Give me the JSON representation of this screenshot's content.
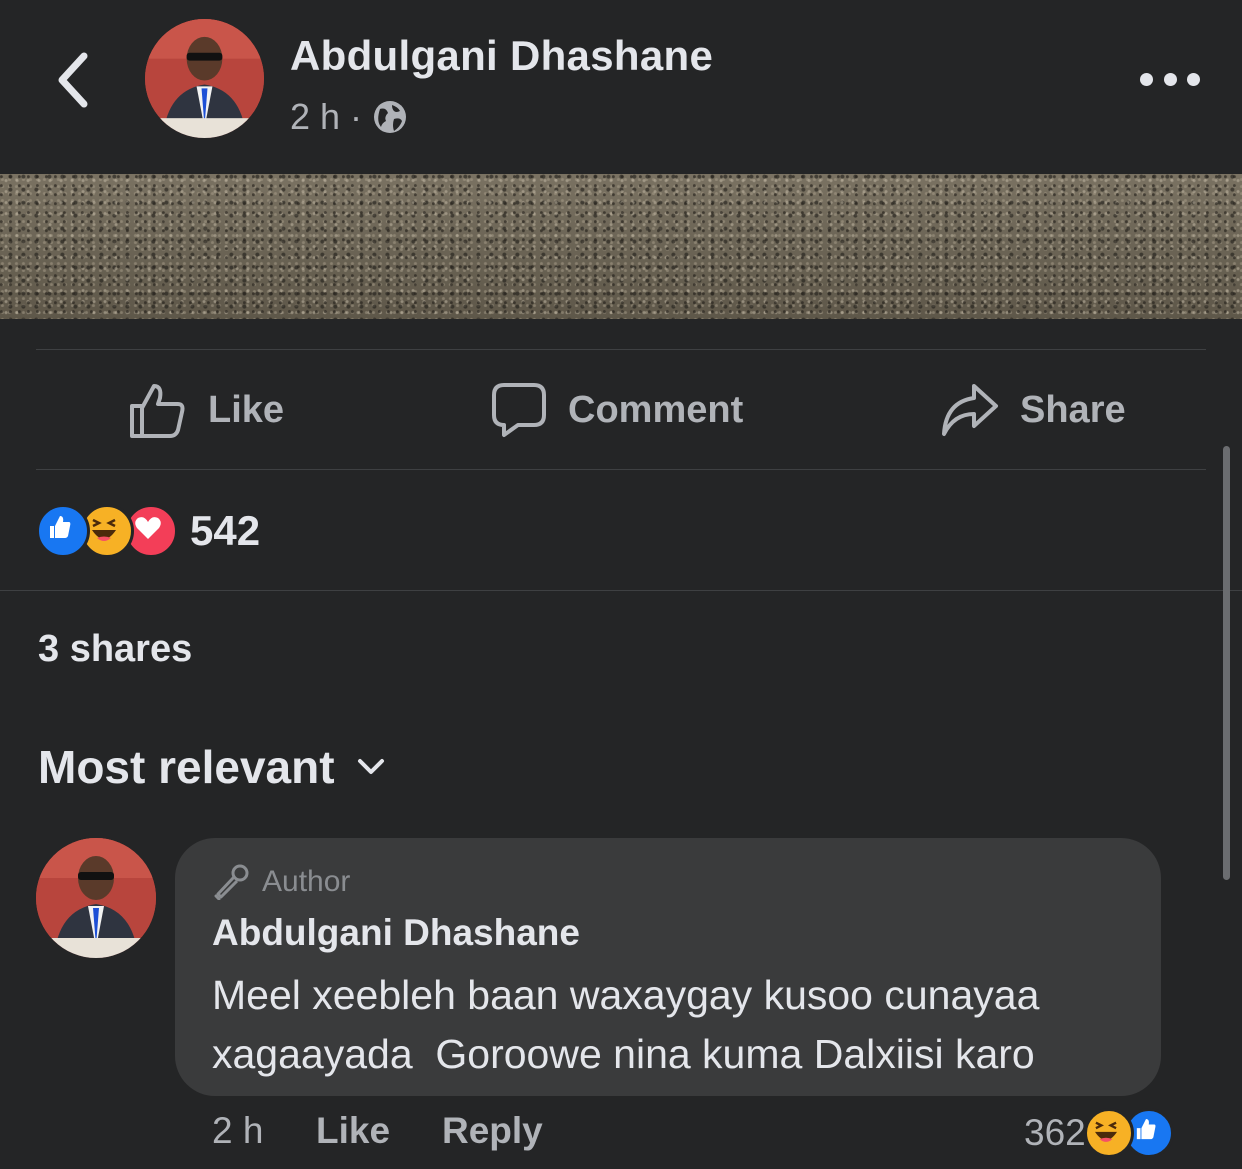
{
  "header": {
    "back_icon": "chevron-left-icon",
    "author_name": "Abdulgani Dhashane",
    "time": "2 h",
    "separator": "·",
    "privacy_icon": "globe-icon",
    "more_icon": "more-horizontal-icon"
  },
  "actions": {
    "like_label": "Like",
    "comment_label": "Comment",
    "share_label": "Share"
  },
  "reactions": {
    "icons": [
      "like-reaction-icon",
      "haha-reaction-icon",
      "love-reaction-icon"
    ],
    "count": "542"
  },
  "shares_text": "3 shares",
  "sort_label": "Most relevant",
  "comment": {
    "badge_label": "Author",
    "author_name": "Abdulgani Dhashane",
    "text": "Meel xeebleh baan waxaygay kusoo cunayaa\nxagaayada  Goroowe nina kuma Dalxiisi karo",
    "time": "2 h",
    "like_label": "Like",
    "reply_label": "Reply",
    "reaction_count": "362",
    "reaction_icons": [
      "haha-reaction-icon",
      "like-reaction-icon"
    ]
  },
  "colors": {
    "background": "#242526",
    "bubble": "#3a3b3c",
    "text_primary": "#e4e6eb",
    "text_secondary": "#b0b3b8",
    "like_blue": "#1877f2",
    "love_red": "#f33e58",
    "haha_yellow": "#f7b125"
  }
}
